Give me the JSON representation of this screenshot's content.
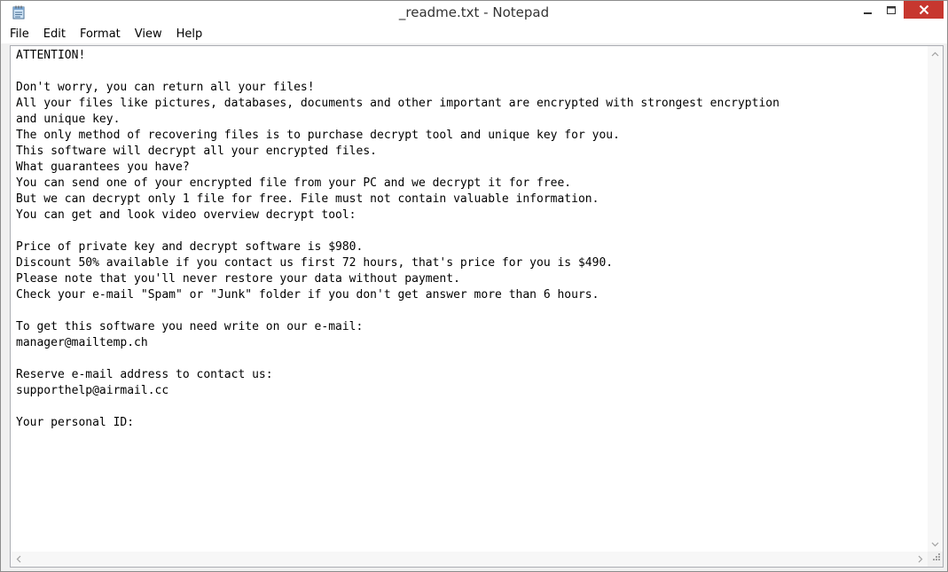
{
  "window": {
    "title": "_readme.txt - Notepad"
  },
  "icons": {
    "app": "notepad-icon",
    "minimize": "minimize-icon",
    "maximize": "maximize-icon",
    "close": "close-icon"
  },
  "colors": {
    "close_button": "#c7372f",
    "background": "#f0f0f0",
    "editor_background": "#ffffff"
  },
  "menu": {
    "file": "File",
    "edit": "Edit",
    "format": "Format",
    "view": "View",
    "help": "Help"
  },
  "document": {
    "content": "ATTENTION!\n\nDon't worry, you can return all your files!\nAll your files like pictures, databases, documents and other important are encrypted with strongest encryption\nand unique key.\nThe only method of recovering files is to purchase decrypt tool and unique key for you.\nThis software will decrypt all your encrypted files.\nWhat guarantees you have?\nYou can send one of your encrypted file from your PC and we decrypt it for free.\nBut we can decrypt only 1 file for free. File must not contain valuable information.\nYou can get and look video overview decrypt tool:\n\nPrice of private key and decrypt software is $980.\nDiscount 50% available if you contact us first 72 hours, that's price for you is $490.\nPlease note that you'll never restore your data without payment.\nCheck your e-mail \"Spam\" or \"Junk\" folder if you don't get answer more than 6 hours.\n\nTo get this software you need write on our e-mail:\nmanager@mailtemp.ch\n\nReserve e-mail address to contact us:\nsupporthelp@airmail.cc\n\nYour personal ID:"
  }
}
